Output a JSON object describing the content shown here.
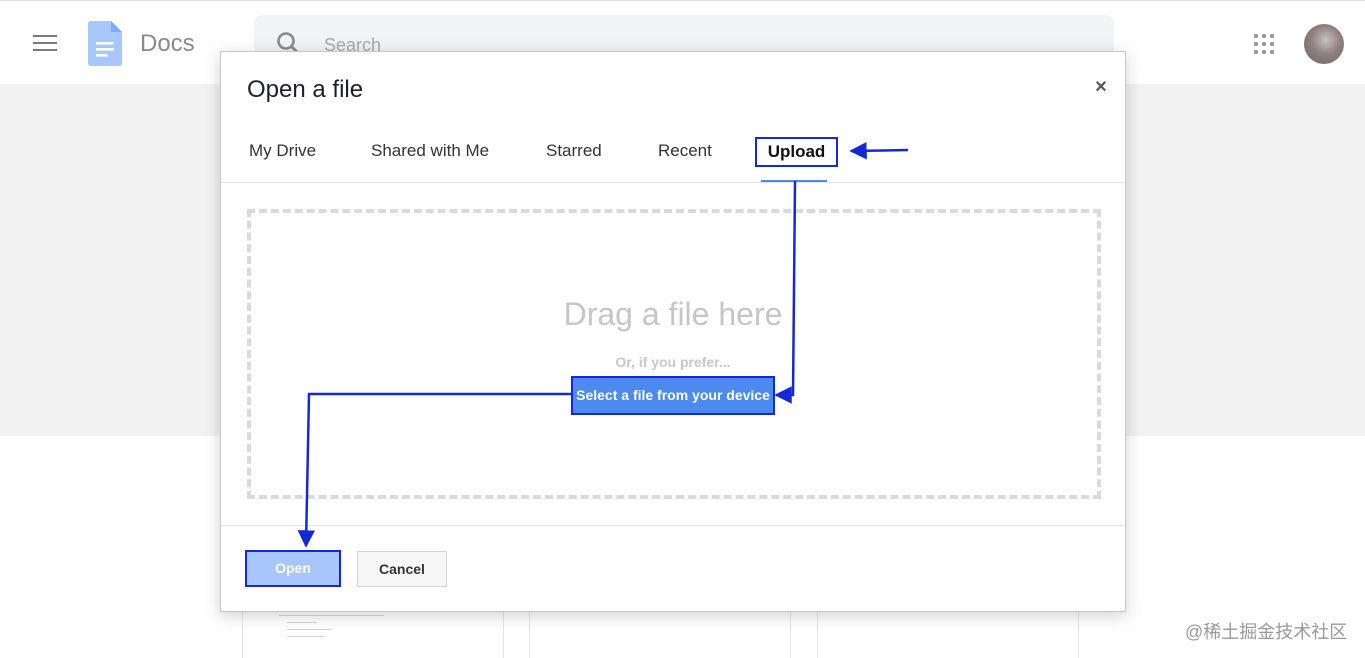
{
  "app": {
    "name": "Docs",
    "search_placeholder": "Search"
  },
  "dialog": {
    "title": "Open a file",
    "close_label": "×",
    "tabs": [
      {
        "label": "My Drive"
      },
      {
        "label": "Shared with Me"
      },
      {
        "label": "Starred"
      },
      {
        "label": "Recent"
      },
      {
        "label": "Upload",
        "selected": true
      }
    ],
    "dropzone": {
      "headline": "Drag a file here",
      "alternative": "Or, if you prefer...",
      "select_button": "Select a file from your device"
    },
    "footer": {
      "open_label": "Open",
      "cancel_label": "Cancel"
    }
  },
  "annotation": {
    "color": "#1428d6"
  },
  "watermark": "@稀土掘金技术社区",
  "colors": {
    "accent": "#4d8af0",
    "open_disabled": "#a9c6fa",
    "tab_underline": "#4a8af4"
  }
}
